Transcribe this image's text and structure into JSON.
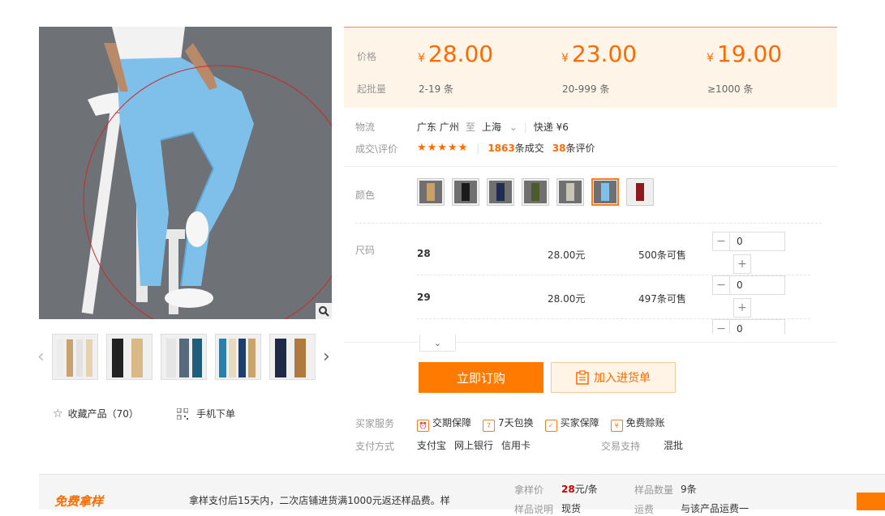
{
  "prices": [
    {
      "currency": "¥",
      "amount": "28.00",
      "range": "2-19 条"
    },
    {
      "currency": "¥",
      "amount": "23.00",
      "range": "20-999 条"
    },
    {
      "currency": "¥",
      "amount": "19.00",
      "range": "≥1000 条"
    }
  ],
  "labels": {
    "price": "价格",
    "moq": "起批量",
    "logistics": "物流",
    "deals": "成交\\评价",
    "color": "颜色",
    "size": "尺码",
    "buyer_service": "买家服务",
    "payment": "支付方式",
    "trade_support": "交易支持"
  },
  "logistics": {
    "from": "广东 广州",
    "to_word": "至",
    "to": "上海",
    "shipping": "快递 ¥6"
  },
  "deals": {
    "stars": "★★★★★",
    "count": "1863",
    "count_unit": "条成交",
    "reviews": "38",
    "reviews_unit": "条评价"
  },
  "sizes": [
    {
      "size": "28",
      "price": "28.00元",
      "stock": "500条可售",
      "qty": "0"
    },
    {
      "size": "29",
      "price": "28.00元",
      "stock": "497条可售",
      "qty": "0"
    },
    {
      "size": "",
      "price": "",
      "stock": "",
      "qty": "0"
    }
  ],
  "buttons": {
    "order": "立即订购",
    "cart": "加入进货单"
  },
  "favorites": "收藏产品（70）",
  "mobile_order": "手机下单",
  "services": [
    "交期保障",
    "7天包换",
    "买家保障",
    "免费赊账"
  ],
  "payments": [
    "支付宝",
    "网上银行",
    "信用卡"
  ],
  "trade_support_value": "混批",
  "bottom": {
    "logo": "免费拿样",
    "desc": "拿样支付后15天内，二次店铺进货满1000元返还样品费。样",
    "sample_price_label": "拿样价",
    "sample_price": "28",
    "sample_price_unit": "元/条",
    "sample_qty_label": "样品数量",
    "sample_qty": "9条",
    "sample_note_label": "样品说明",
    "sample_note": "现货",
    "freight_label": "运费",
    "freight": "与该产品运费一"
  },
  "colors": {
    "accent": "#ff6a00",
    "price_bg": "#fff4e8"
  }
}
